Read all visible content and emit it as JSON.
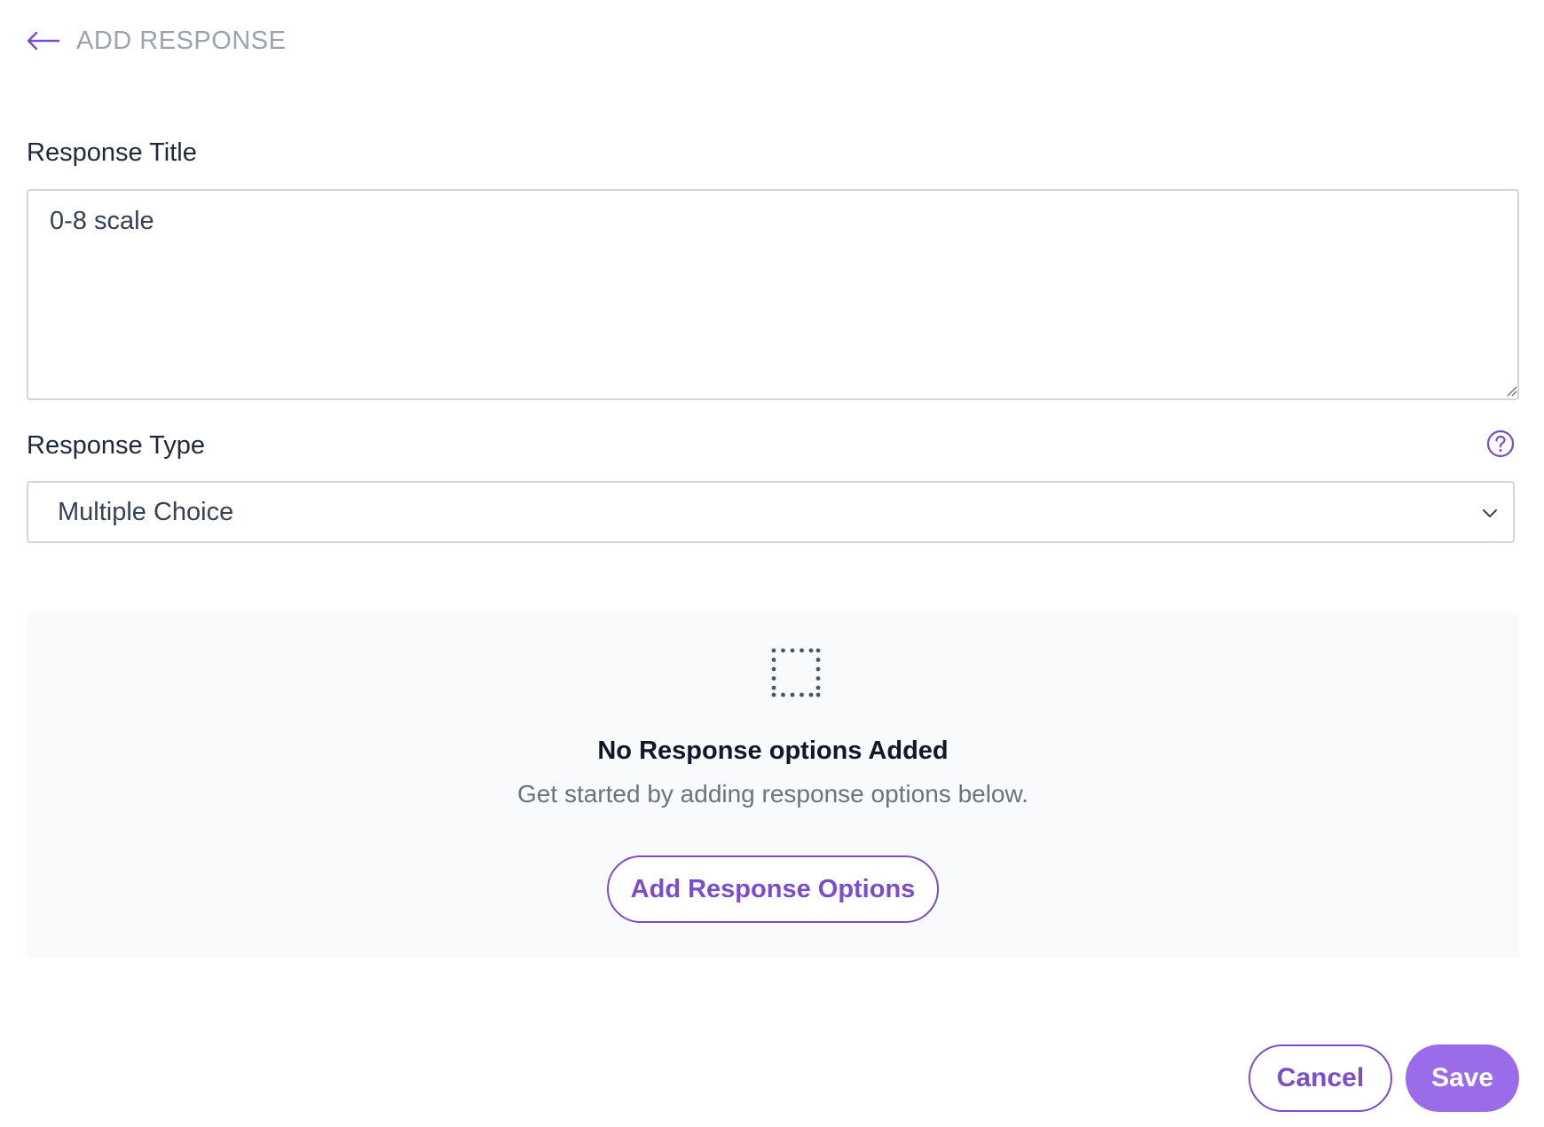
{
  "header": {
    "back_icon": "arrow-left-icon",
    "title": "ADD RESPONSE"
  },
  "form": {
    "response_title": {
      "label": "Response Title",
      "value": "0-8 scale"
    },
    "response_type": {
      "label": "Response Type",
      "selected": "Multiple Choice",
      "help_icon": "question-circle-icon",
      "dropdown_icon": "chevron-down-icon"
    }
  },
  "empty_state": {
    "icon": "dotted-square-icon",
    "title": "No Response options Added",
    "subtitle": "Get started by adding response options below.",
    "button_label": "Add Response Options"
  },
  "footer": {
    "cancel_label": "Cancel",
    "save_label": "Save"
  },
  "colors": {
    "accent": "#7c4dcb",
    "save_bg": "#9b6cea",
    "muted_text": "#9ca3af",
    "empty_bg": "#f9fafb"
  }
}
